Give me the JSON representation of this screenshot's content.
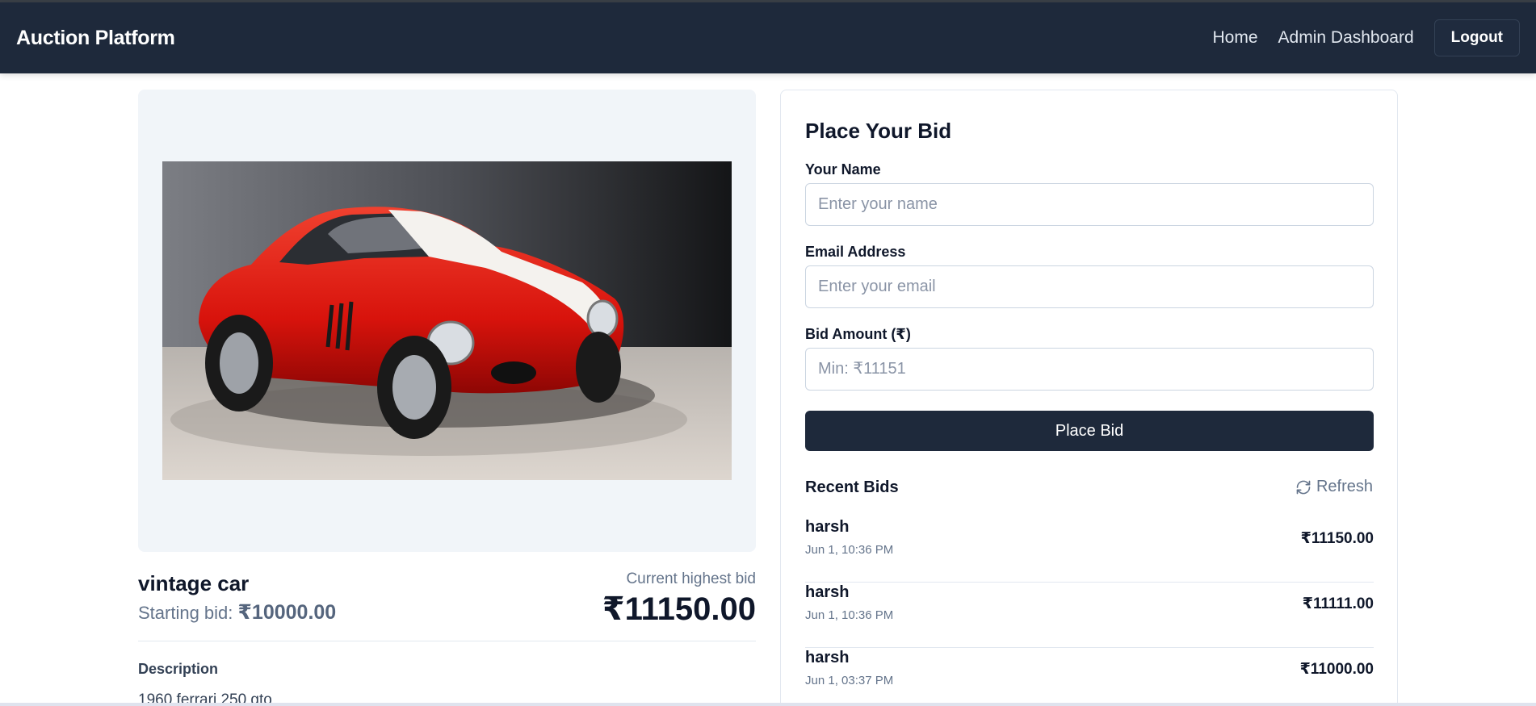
{
  "navbar": {
    "brand": "Auction Platform",
    "links": [
      "Home",
      "Admin Dashboard"
    ],
    "logout_label": "Logout",
    "bg_color": "#1e293b"
  },
  "item": {
    "title": "vintage car",
    "starting_bid_label": "Starting bid:",
    "starting_bid_value": "₹10000.00",
    "current_bid_label": "Current highest bid",
    "current_bid_value": "₹11150.00",
    "description_label": "Description",
    "description_text": "1960 ferrari 250 gto"
  },
  "bid_form": {
    "heading": "Place Your Bid",
    "name_label": "Your Name",
    "name_placeholder": "Enter your name",
    "email_label": "Email Address",
    "email_placeholder": "Enter your email",
    "amount_label": "Bid Amount (₹)",
    "amount_placeholder": "Min: ₹11151",
    "submit_label": "Place Bid"
  },
  "recent_bids": {
    "heading": "Recent Bids",
    "refresh_label": "Refresh",
    "refresh_icon": "refresh-icon",
    "items": [
      {
        "name": "harsh",
        "time": "Jun 1, 10:36 PM",
        "amount": "₹11150.00"
      },
      {
        "name": "harsh",
        "time": "Jun 1, 10:36 PM",
        "amount": "₹11111.00"
      },
      {
        "name": "harsh",
        "time": "Jun 1, 03:37 PM",
        "amount": "₹11000.00"
      }
    ]
  }
}
